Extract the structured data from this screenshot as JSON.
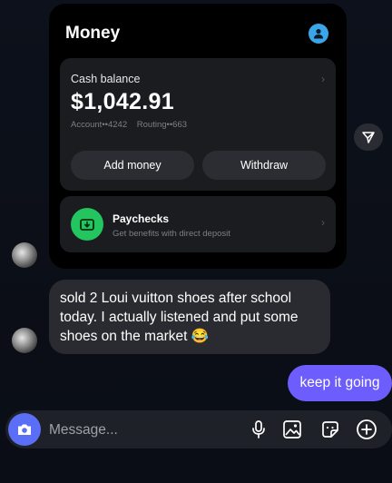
{
  "money_card": {
    "title": "Money",
    "cash_label": "Cash balance",
    "balance": "$1,042.91",
    "account": "Account••4242",
    "routing": "Routing••663",
    "add_money": "Add money",
    "withdraw": "Withdraw",
    "paycheck_title": "Paychecks",
    "paycheck_subtitle": "Get benefits with direct deposit"
  },
  "messages": {
    "received_text": "sold 2 Loui vuitton shoes after school today. I actually listened and put some shoes on the market 😂",
    "sent_text": "keep it going"
  },
  "composer": {
    "placeholder": "Message..."
  },
  "colors": {
    "sent_bubble": "#6d5dfc",
    "received_bubble": "#2a2b30",
    "paycheck_green": "#22c55e",
    "camera_blue": "#5b6ef7"
  },
  "icons": [
    "profile-icon",
    "chevron-right-icon",
    "paycheck-icon",
    "share-icon",
    "camera-icon",
    "microphone-icon",
    "gallery-icon",
    "sticker-icon",
    "plus-icon"
  ]
}
